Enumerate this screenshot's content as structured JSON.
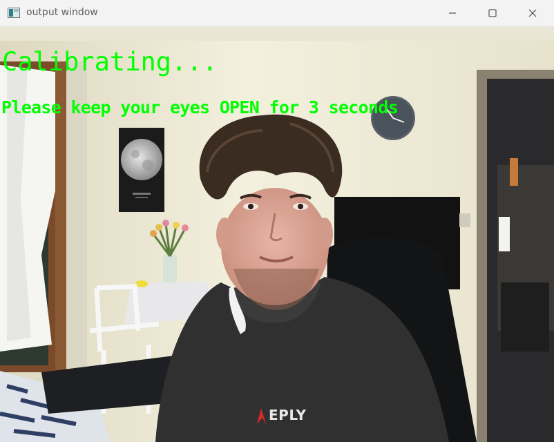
{
  "window": {
    "title": "output window",
    "controls": {
      "minimize_icon": "minimize-icon",
      "maximize_icon": "maximize-icon",
      "close_icon": "close-icon"
    }
  },
  "overlay": {
    "status": "Calibrating...",
    "instruction": "Please keep your eyes OPEN for 3 seconds",
    "color": "#00ff00"
  },
  "scene": {
    "shirt_logo": "EPLY"
  }
}
